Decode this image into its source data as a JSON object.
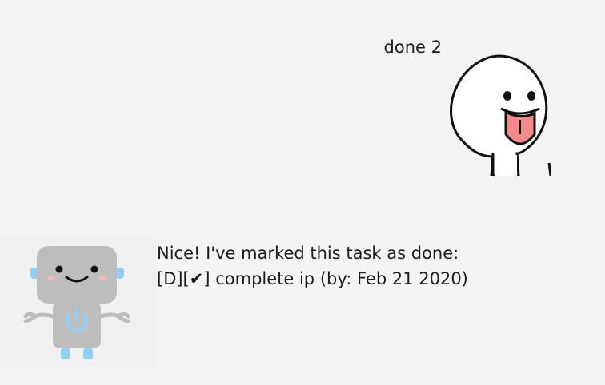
{
  "messages": [
    {
      "sender": "user",
      "text": "done 2",
      "avatar_icon": "tongue-out-face-icon"
    },
    {
      "sender": "bot",
      "lines": [
        "Nice! I've marked this task as done:",
        "[D][✔] complete ip (by: Feb 21 2020)"
      ],
      "avatar_icon": "robot-power-icon"
    }
  ],
  "colors": {
    "background": "#f4f4f4",
    "bot_body": "#bdbdbd",
    "bot_accent": "#8fd0f5",
    "tongue": "#f28a8a"
  }
}
